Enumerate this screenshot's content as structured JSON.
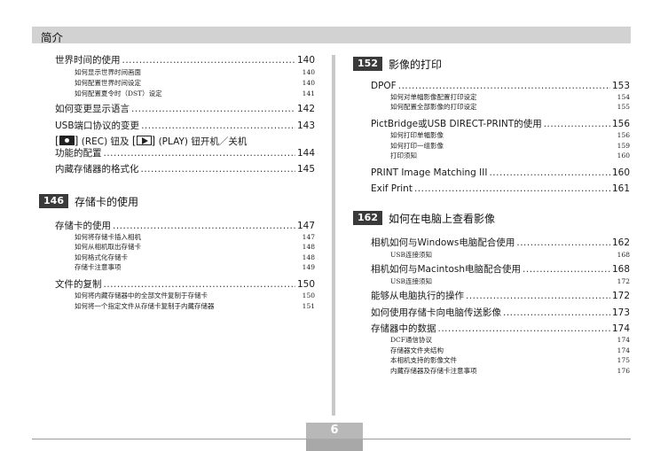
{
  "header": {
    "title": "简介"
  },
  "left": {
    "e0": {
      "title": "世界时间的使用",
      "page": "140"
    },
    "e0s": [
      {
        "title": "如何显示世界时间画面",
        "page": "140"
      },
      {
        "title": "如何配置世界时间设定",
        "page": "140"
      },
      {
        "title": "如何配置夏令时（DST）设定",
        "page": "141"
      }
    ],
    "e1": {
      "title": "如何变更显示语言",
      "page": "142"
    },
    "e2": {
      "title": "USB端口协议的变更",
      "page": "143"
    },
    "e3": {
      "line1_a": "(REC) 钮及",
      "line1_b": "(PLAY) 钮开机／关机",
      "title": "功能的配置",
      "page": "144",
      "icon1": "camera-icon",
      "icon2": "play-icon"
    },
    "e4": {
      "title": "内藏存储器的格式化",
      "page": "145"
    },
    "sec146": {
      "num": "146",
      "title": "存储卡的使用"
    },
    "e5": {
      "title": "存储卡的使用",
      "page": "147"
    },
    "e5s": [
      {
        "title": "如何将存储卡插入相机",
        "page": "147"
      },
      {
        "title": "如何从相机取出存储卡",
        "page": "148"
      },
      {
        "title": "如何格式化存储卡",
        "page": "148"
      },
      {
        "title": "存储卡注意事项",
        "page": "149"
      }
    ],
    "e6": {
      "title": "文件的复制",
      "page": "150"
    },
    "e6s": [
      {
        "title": "如何将内藏存储器中的全部文件复制于存储卡",
        "page": "150"
      },
      {
        "title": "如何将一个指定文件从存储卡复制于内藏存储器",
        "page": "151"
      }
    ]
  },
  "right": {
    "sec152": {
      "num": "152",
      "title": "影像的打印"
    },
    "r0": {
      "title": "DPOF",
      "page": "153"
    },
    "r0s": [
      {
        "title": "如何对单幅影像配置打印设定",
        "page": "154"
      },
      {
        "title": "如何配置全部影像的打印设定",
        "page": "155"
      }
    ],
    "r1": {
      "title": "PictBridge或USB DIRECT-PRINT的使用",
      "page": "156"
    },
    "r1s": [
      {
        "title": "如何打印单幅影像",
        "page": "156"
      },
      {
        "title": "如何打印一组影像",
        "page": "159"
      },
      {
        "title": "打印须知",
        "page": "160"
      }
    ],
    "r2": {
      "title": "PRINT Image Matching III",
      "page": "160"
    },
    "r3": {
      "title": "Exif Print",
      "page": "161"
    },
    "sec162": {
      "num": "162",
      "title": "如何在电脑上查看影像"
    },
    "r4": {
      "title": "相机如何与Windows电脑配合使用",
      "page": "162"
    },
    "r4s": [
      {
        "title": "USB连接须知",
        "page": "168"
      }
    ],
    "r5": {
      "title": "相机如何与Macintosh电脑配合使用",
      "page": "168"
    },
    "r5s": [
      {
        "title": "USB连接须知",
        "page": "172"
      }
    ],
    "r6": {
      "title": "能够从电脑执行的操作",
      "page": "172"
    },
    "r7": {
      "title": "如何使用存储卡向电脑传送影像",
      "page": "173"
    },
    "r8": {
      "title": "存储器中的数据",
      "page": "174"
    },
    "r8s": [
      {
        "title": "DCF通信协议",
        "page": "174"
      },
      {
        "title": "存储器文件夹结构",
        "page": "174"
      },
      {
        "title": "本相机支持的影像文件",
        "page": "175"
      },
      {
        "title": "内藏存储器及存储卡注意事项",
        "page": "176"
      }
    ]
  },
  "footer": {
    "page_number": "6"
  }
}
